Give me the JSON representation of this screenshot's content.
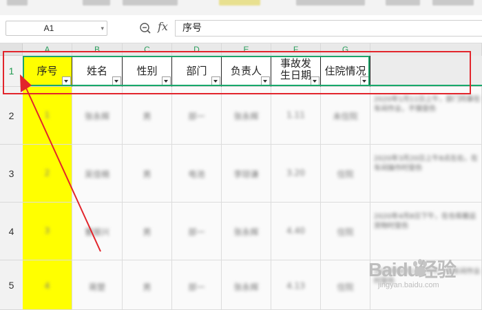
{
  "name_box": {
    "value": "A1"
  },
  "formula_bar": {
    "content": "序号"
  },
  "columns": [
    {
      "letter": "A",
      "header": "序号"
    },
    {
      "letter": "B",
      "header": "姓名"
    },
    {
      "letter": "C",
      "header": "性别"
    },
    {
      "letter": "D",
      "header": "部门"
    },
    {
      "letter": "E",
      "header": "负责人"
    },
    {
      "letter": "F",
      "header": "事故发\n生日期"
    },
    {
      "letter": "G",
      "header": "住院情况"
    }
  ],
  "rows": [
    {
      "num": "1"
    },
    {
      "num": "2",
      "cells": [
        "1",
        "张永辉",
        "男",
        "部一",
        "张永辉",
        "1.11",
        "未住院",
        "2020年1月11日上午，部门同事在车间作业，不慎受伤"
      ]
    },
    {
      "num": "3",
      "cells": [
        "2",
        "吴佳楠",
        "男",
        "电池",
        "李琼谦",
        "3.20",
        "住院",
        "2020年3月20日上午8点左右，在车间操作时受伤"
      ]
    },
    {
      "num": "4",
      "cells": [
        "3",
        "曹振兴",
        "男",
        "部一",
        "张永辉",
        "4.40",
        "住院",
        "2020年4月8日下午，在仓库搬运货物时受伤"
      ]
    },
    {
      "num": "5",
      "cells": [
        "4",
        "蒋楚",
        "男",
        "部一",
        "张永辉",
        "4.13",
        "住院",
        "2020年4月13日下午，在车间作业时受伤"
      ]
    }
  ],
  "watermark": {
    "main": "Baidu经验",
    "sub": "jingyan.baidu.com"
  },
  "colors": {
    "highlight": "#ffff00",
    "selection": "#1ba56a",
    "annotation": "#e2242b"
  }
}
